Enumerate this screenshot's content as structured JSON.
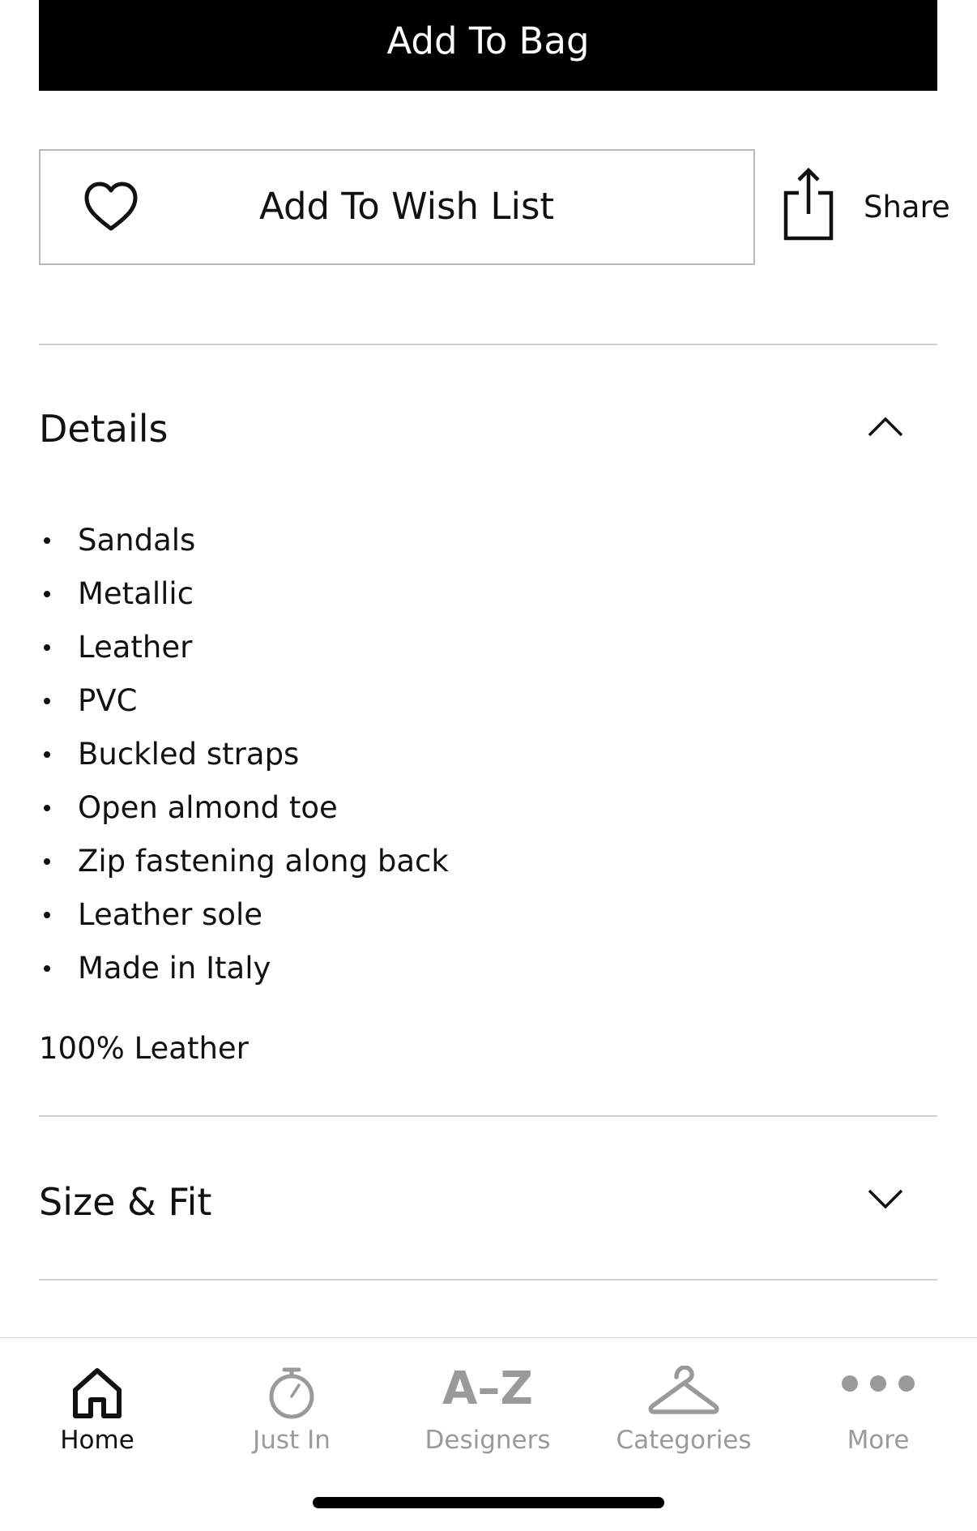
{
  "actions": {
    "add_to_bag": "Add To Bag",
    "add_to_wish_list": "Add To Wish List",
    "share": "Share"
  },
  "details": {
    "title": "Details",
    "expanded": true,
    "items": [
      "Sandals",
      "Metallic",
      "Leather",
      "PVC",
      "Buckled straps",
      "Open almond toe",
      "Zip fastening along back",
      "Leather sole",
      "Made in Italy"
    ],
    "composition": "100% Leather"
  },
  "size_fit": {
    "title": "Size & Fit",
    "expanded": false
  },
  "tabbar": {
    "active": "home",
    "tabs": [
      {
        "id": "home",
        "label": "Home",
        "icon": "home-icon"
      },
      {
        "id": "just-in",
        "label": "Just In",
        "icon": "stopwatch-icon"
      },
      {
        "id": "designers",
        "label": "Designers",
        "icon": "a-z-icon",
        "icon_text": "A–Z"
      },
      {
        "id": "categories",
        "label": "Categories",
        "icon": "hanger-icon"
      },
      {
        "id": "more",
        "label": "More",
        "icon": "more-dots-icon"
      }
    ]
  },
  "colors": {
    "primary": "#000000",
    "text": "#111111",
    "inactive": "#9a9a9a",
    "border": "#b9b9b9",
    "divider": "#cfcfcf"
  }
}
